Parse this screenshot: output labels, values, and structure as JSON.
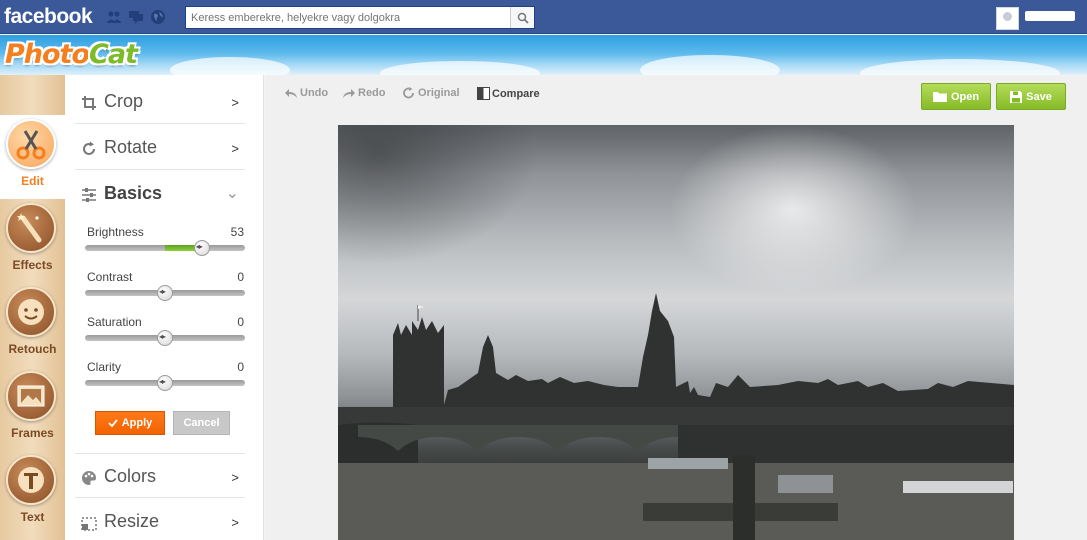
{
  "facebook": {
    "logo": "facebook",
    "search_placeholder": "Keress emberekre, helyekre vagy dolgokra"
  },
  "app": {
    "logo_photo": "Photo",
    "logo_cat": "Cat"
  },
  "rail": {
    "items": [
      {
        "label": "Edit",
        "icon": "scissors-icon",
        "active": true
      },
      {
        "label": "Effects",
        "icon": "magic-wand-icon"
      },
      {
        "label": "Retouch",
        "icon": "face-icon"
      },
      {
        "label": "Frames",
        "icon": "frame-icon"
      },
      {
        "label": "Text",
        "icon": "text-icon"
      }
    ]
  },
  "panel": {
    "crop": "Crop",
    "rotate": "Rotate",
    "basics": "Basics",
    "colors": "Colors",
    "resize": "Resize",
    "chevron_right": ">",
    "chevron_down": "⌄",
    "sliders": [
      {
        "name": "Brightness",
        "value": "53",
        "fraction": 0.73
      },
      {
        "name": "Contrast",
        "value": "0",
        "fraction": 0.5
      },
      {
        "name": "Saturation",
        "value": "0",
        "fraction": 0.5
      },
      {
        "name": "Clarity",
        "value": "0",
        "fraction": 0.5
      }
    ],
    "apply": "Apply",
    "cancel": "Cancel"
  },
  "toolbar": {
    "undo": "Undo",
    "redo": "Redo",
    "original": "Original",
    "compare": "Compare",
    "open": "Open",
    "save": "Save"
  },
  "colors": {
    "facebook_blue": "#3b5998",
    "accent_orange": "#f57f1e",
    "accent_green": "#86bb28"
  }
}
